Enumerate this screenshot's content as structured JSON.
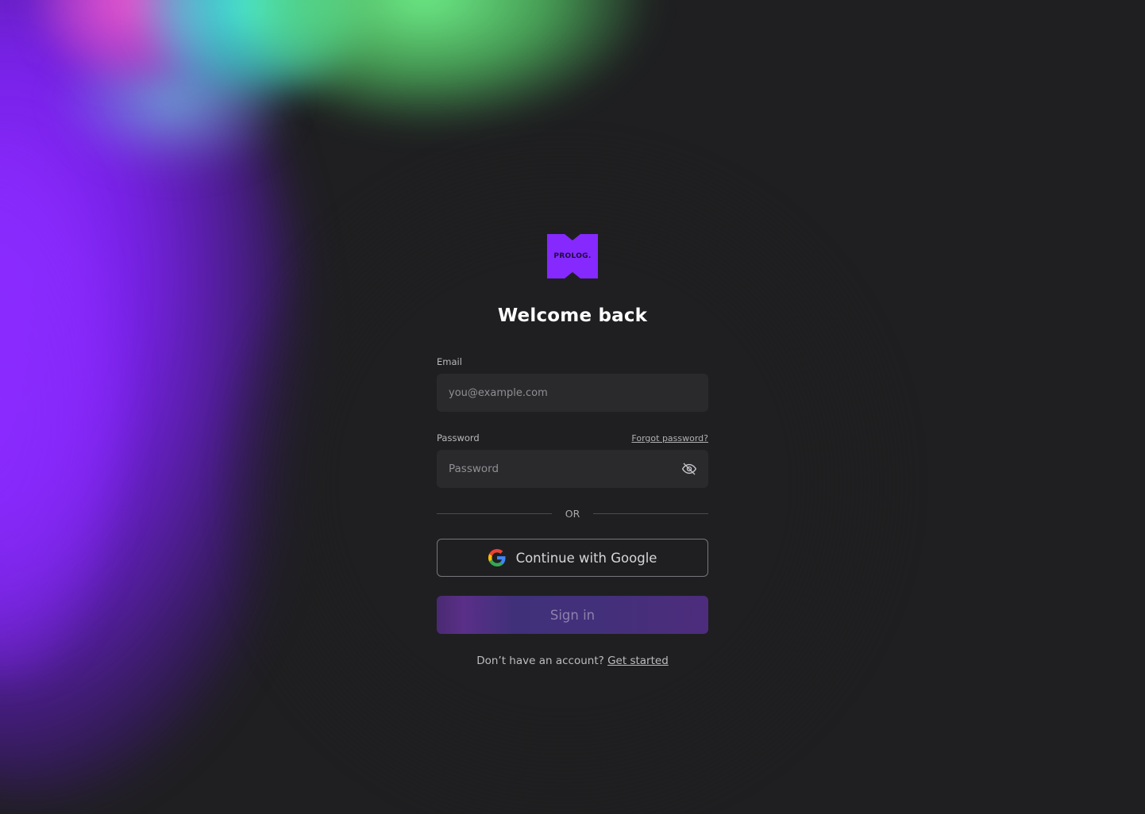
{
  "logo": {
    "text": "PROLOG.",
    "color": "#8529ff"
  },
  "heading": "Welcome back",
  "email": {
    "label": "Email",
    "placeholder": "you@example.com",
    "value": ""
  },
  "password": {
    "label": "Password",
    "placeholder": "Password",
    "value": "",
    "forgot_link": "Forgot password?",
    "toggle_icon": "eye-off-icon"
  },
  "divider_text": "OR",
  "google_button": {
    "label": "Continue with Google",
    "icon": "google-icon"
  },
  "signin_button": {
    "label": "Sign in",
    "state": "disabled"
  },
  "footer": {
    "prompt": "Don’t have an account?",
    "link": "Get started"
  },
  "colors": {
    "background": "#1f1f21",
    "input_background": "#2a2a2d",
    "accent_purple": "#8529ff",
    "aurora_pink": "#f05ad2",
    "aurora_cyan": "#4af3ef",
    "aurora_green": "#6ff08a"
  }
}
